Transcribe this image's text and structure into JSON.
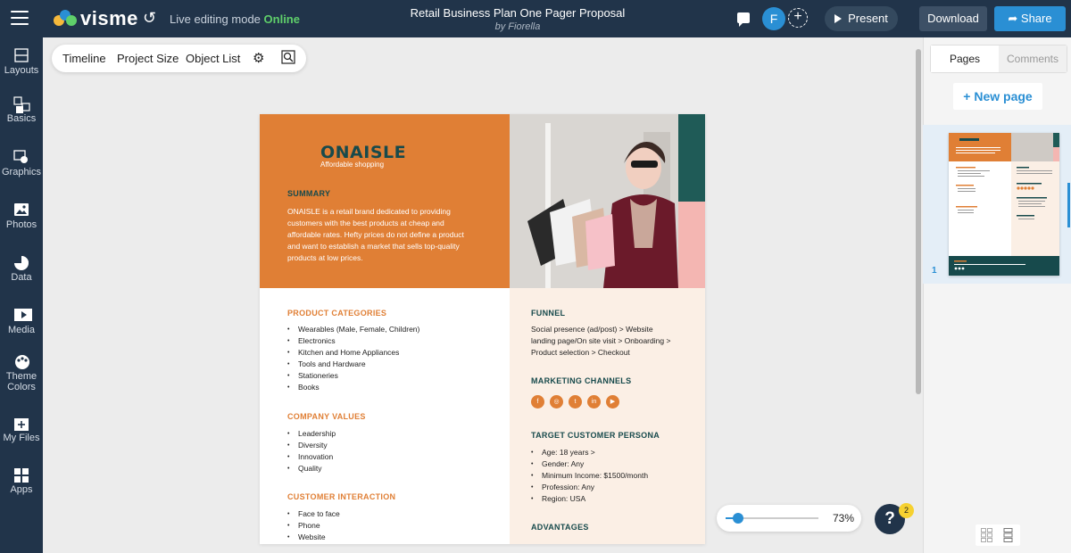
{
  "topbar": {
    "logo_text": "visme",
    "mode_label": "Live editing mode",
    "mode_status": "Online",
    "doc_title": "Retail Business Plan One Pager Proposal",
    "doc_author": "by Fiorella",
    "avatar_initial": "F",
    "present_label": "Present",
    "download_label": "Download",
    "share_label": "Share"
  },
  "sidebar": {
    "items": [
      {
        "label": "Layouts",
        "icon": "layouts-icon"
      },
      {
        "label": "Basics",
        "icon": "basics-icon"
      },
      {
        "label": "Graphics",
        "icon": "graphics-icon"
      },
      {
        "label": "Photos",
        "icon": "photos-icon"
      },
      {
        "label": "Data",
        "icon": "data-icon"
      },
      {
        "label": "Media",
        "icon": "media-icon"
      },
      {
        "label": "Theme",
        "label2": "Colors",
        "icon": "theme-colors-icon"
      },
      {
        "label": "My Files",
        "icon": "my-files-icon"
      },
      {
        "label": "Apps",
        "icon": "apps-icon"
      }
    ]
  },
  "toolbar": {
    "timeline": "Timeline",
    "project_size": "Project Size",
    "object_list": "Object List"
  },
  "document": {
    "brand": "ONAISLE",
    "tagline": "Affordable shopping",
    "summary_heading": "SUMMARY",
    "summary_lines": [
      "ONAISLE is a retail brand dedicated to providing",
      "customers with the best products at cheap and",
      "affordable rates. Hefty prices do not define a product",
      "and want to establish a market that sells top-quality",
      "products at low prices."
    ],
    "product_categories": {
      "heading": "PRODUCT CATEGORIES",
      "items": [
        "Wearables (Male, Female, Children)",
        "Electronics",
        "Kitchen and Home Appliances",
        "Tools and Hardware",
        "Stationeries",
        "Books"
      ]
    },
    "company_values": {
      "heading": "COMPANY VALUES",
      "items": [
        "Leadership",
        "Diversity",
        "Innovation",
        "Quality"
      ]
    },
    "customer_interaction": {
      "heading": "CUSTOMER INTERACTION",
      "items": [
        "Face to face",
        "Phone",
        "Website"
      ]
    },
    "funnel": {
      "heading": "FUNNEL",
      "lines": [
        "Social presence (ad/post) > Website",
        "landing page/On site visit > Onboarding >",
        "Product selection > Checkout"
      ]
    },
    "marketing_channels": {
      "heading": "MARKETING CHANNELS",
      "icons": [
        "facebook-icon",
        "instagram-icon",
        "twitter-icon",
        "linkedin-icon",
        "youtube-icon"
      ],
      "glyphs": [
        "f",
        "◎",
        "t",
        "in",
        "▶"
      ]
    },
    "target_persona": {
      "heading": "TARGET CUSTOMER PERSONA",
      "items": [
        "Age: 18 years >",
        "Gender: Any",
        "Minimum Income: $1500/month",
        "Profession: Any",
        "Region: USA"
      ]
    },
    "advantages": {
      "heading": "ADVANTAGES"
    }
  },
  "right_panel": {
    "tab_pages": "Pages",
    "tab_comments": "Comments",
    "new_page": "+ New page",
    "page_number": "1"
  },
  "zoom": {
    "value": "73%",
    "level": 0.73
  },
  "help": {
    "label": "?",
    "badge": "2"
  },
  "colors": {
    "nav_bg": "#21344a",
    "accent_blue": "#2a8fd4",
    "orange": "#e07f35",
    "teal": "#1f5b57",
    "pink": "#f4b6b2",
    "cream": "#fbefe5",
    "online_green": "#5fcf6a"
  }
}
